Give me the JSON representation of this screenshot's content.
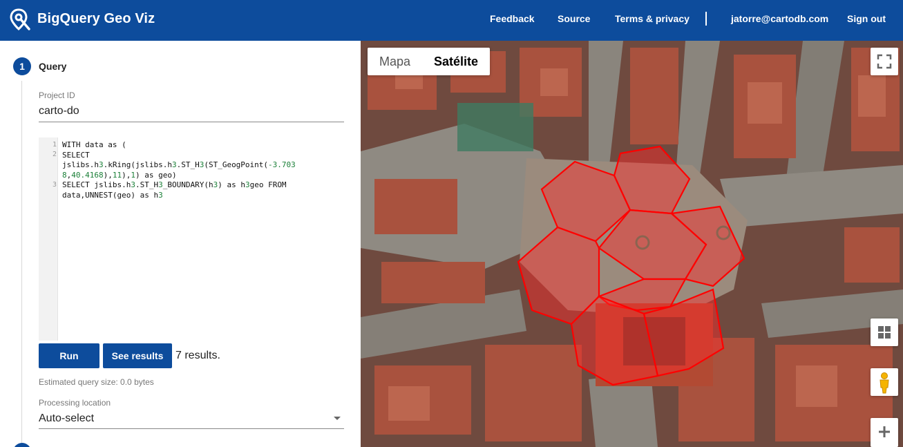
{
  "header": {
    "app_title": "BigQuery Geo Viz",
    "logo_icon": "map-pin-search-icon",
    "nav": {
      "feedback": "Feedback",
      "source": "Source",
      "terms": "Terms & privacy",
      "user_email": "jatorre@cartodb.com",
      "sign_out": "Sign out"
    }
  },
  "sidebar": {
    "step1": {
      "number": "1",
      "label": "Query"
    },
    "project": {
      "label": "Project ID",
      "value": "carto-do"
    },
    "editor": {
      "line_numbers": [
        "1",
        "2",
        "3"
      ],
      "lines": [
        "WITH data as (",
        "SELECT",
        "jslibs.h3.kRing(jslibs.h3.ST_H3(ST_GeogPoint(-3.703",
        "8,40.4168),11),1) as geo)",
        "SELECT jslibs.h3.ST_H3_BOUNDARY(h3) as h3geo FROM",
        "data,UNNEST(geo) as h3"
      ]
    },
    "run_label": "Run",
    "see_results_label": "See results",
    "results_text": "7 results.",
    "estimated_size": "Estimated query size: 0.0 bytes",
    "processing": {
      "label": "Processing location",
      "value": "Auto-select"
    }
  },
  "map": {
    "type_map": "Mapa",
    "type_satellite": "Satélite",
    "selected_type": "Satélite",
    "fullscreen_icon": "fullscreen-icon",
    "tilt_icon": "grid-icon",
    "streetview_icon": "pegman-icon",
    "zoom_in_icon": "plus-icon",
    "hex_stroke": "#ff0000",
    "hex_fill": "#ff2a2a"
  },
  "colors": {
    "brand": "#0d4c9c",
    "header_text": "#ffffff"
  }
}
